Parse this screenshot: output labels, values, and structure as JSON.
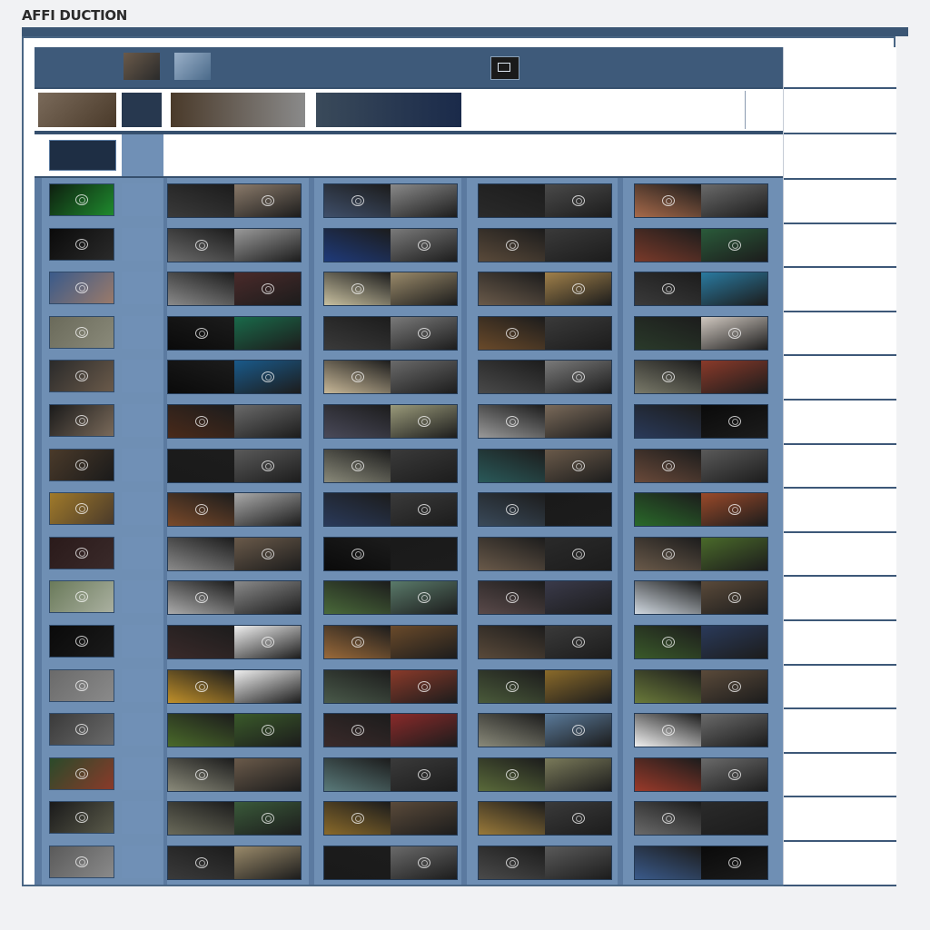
{
  "app": {
    "title": "AFFI DUCTION",
    "subtitle": "",
    "footer": ""
  },
  "colors": {
    "title_bar": "#3b5674",
    "column_blue": "#6f8fb4",
    "header_dark": "#3e5a7a",
    "cell_dark": "#27384f"
  },
  "header": {
    "badge_icon": "image-icon"
  },
  "info_rows": [],
  "grid": {
    "rows": [
      {
        "key": "",
        "thumb": [
          "#0e1f0f",
          "#1f8a2e"
        ],
        "cells": [
          [
            "#3a3a3a",
            "#8a7a6a"
          ],
          [
            "#3f4f6a",
            "#8a8a8a"
          ],
          [
            "#2a2a2a",
            "#4a4a4a"
          ],
          [
            "#a86a4a",
            "#6a6a6a"
          ]
        ]
      },
      {
        "key": "",
        "thumb": [
          "#0a0a0a",
          "#2a2a2a"
        ],
        "cells": [
          [
            "#6a6a6a",
            "#9a9a9a"
          ],
          [
            "#1e3a7a",
            "#7a7a7a"
          ],
          [
            "#5a4a3a",
            "#3a3a3a"
          ],
          [
            "#7a3a2a",
            "#2a5a3a"
          ]
        ]
      },
      {
        "key": "",
        "thumb": [
          "#3a5a8a",
          "#9a7a6a"
        ],
        "cells": [
          [
            "#8a8a8a",
            "#4a2a2a"
          ],
          [
            "#c8c0a0",
            "#9a8a6a"
          ],
          [
            "#6a5a4a",
            "#a0804a"
          ],
          [
            "#3a3a3a",
            "#2a7aa0"
          ]
        ]
      },
      {
        "key": "",
        "thumb": [
          "#6a6a5a",
          "#8a8a7a"
        ],
        "cells": [
          [
            "#0a0a0a",
            "#1a6a4a"
          ],
          [
            "#3a3a3a",
            "#7a7a7a"
          ],
          [
            "#6a4a2a",
            "#3a3a3a"
          ],
          [
            "#2a3a2a",
            "#d0c8c0"
          ]
        ]
      },
      {
        "key": "",
        "thumb": [
          "#2a2a2a",
          "#6a5a4a"
        ],
        "cells": [
          [
            "#0a0a0a",
            "#1a5a8a"
          ],
          [
            "#c8b898",
            "#6a6a6a"
          ],
          [
            "#4a4a4a",
            "#7a7a7a"
          ],
          [
            "#7a7a6a",
            "#8a3a2a"
          ]
        ]
      },
      {
        "key": "",
        "thumb": [
          "#1a1a1a",
          "#7a6a5a"
        ],
        "cells": [
          [
            "#4a2a1a",
            "#6a6a6a"
          ],
          [
            "#4a4a5a",
            "#9a9a7a"
          ],
          [
            "#9a9a9a",
            "#7a6a5a"
          ],
          [
            "#2a3a5a",
            "#0a0a0a"
          ]
        ]
      },
      {
        "key": "",
        "thumb": [
          "#4a3a2a",
          "#1a1a1a"
        ],
        "cells": [
          [
            "#1a1a1a",
            "#5a5a5a"
          ],
          [
            "#8a8a7a",
            "#3a3a3a"
          ],
          [
            "#2a5a5a",
            "#6a5a4a"
          ],
          [
            "#6a4a3a",
            "#5a5a5a"
          ]
        ]
      },
      {
        "key": "",
        "thumb": [
          "#a07a2a",
          "#4a3a2a"
        ],
        "cells": [
          [
            "#7a4a2a",
            "#aaaaaa"
          ],
          [
            "#2a3a5a",
            "#3a3a3a"
          ],
          [
            "#3a4a5a",
            "#1a1a1a"
          ],
          [
            "#2a6a2a",
            "#9a4a2a"
          ]
        ]
      },
      {
        "key": "",
        "thumb": [
          "#2a1a1a",
          "#3a2a2a"
        ],
        "cells": [
          [
            "#8a8a8a",
            "#6a5a4a"
          ],
          [
            "#0a0a0a",
            "#1a1a1a"
          ],
          [
            "#6a5a4a",
            "#2a2a2a"
          ],
          [
            "#6a5a4a",
            "#4a6a2a"
          ]
        ]
      },
      {
        "key": "",
        "thumb": [
          "#6a7a5a",
          "#aab0a0"
        ],
        "cells": [
          [
            "#aaaaaa",
            "#8a8a8a"
          ],
          [
            "#4a6a3a",
            "#5a7a6a"
          ],
          [
            "#5a4a4a",
            "#3a3a4a"
          ],
          [
            "#d0d8e0",
            "#5a4a3a"
          ]
        ]
      },
      {
        "key": "",
        "thumb": [
          "#0a0a0a",
          "#1a1a1a"
        ],
        "cells": [
          [
            "#3a2a2a",
            "#f0f0f0"
          ],
          [
            "#9a6a3a",
            "#6a4a2a"
          ],
          [
            "#5a4a3a",
            "#3a3a3a"
          ],
          [
            "#3a5a2a",
            "#2a3a5a"
          ]
        ]
      },
      {
        "key": "",
        "thumb": [
          "#6a6a6a",
          "#8a8a8a"
        ],
        "cells": [
          [
            "#c0902a",
            "#f0f0f0"
          ],
          [
            "#4a5a4a",
            "#8a3a2a"
          ],
          [
            "#4a5a3a",
            "#8a6a2a"
          ],
          [
            "#6a7a3a",
            "#5a4a3a"
          ]
        ]
      },
      {
        "key": "",
        "thumb": [
          "#3a3a3a",
          "#6a6a6a"
        ],
        "cells": [
          [
            "#4a6a2a",
            "#3a5a2a"
          ],
          [
            "#3a2a2a",
            "#8a2a2a"
          ],
          [
            "#8a8a7a",
            "#5a7a9a"
          ],
          [
            "#f0f0f0",
            "#6a6a6a"
          ]
        ]
      },
      {
        "key": "",
        "thumb": [
          "#2a4a2a",
          "#8a3a2a"
        ],
        "cells": [
          [
            "#8a8a7a",
            "#6a5a4a"
          ],
          [
            "#5a7a7a",
            "#3a3a3a"
          ],
          [
            "#5a6a3a",
            "#7a7a5a"
          ],
          [
            "#9a3a2a",
            "#6a6a6a"
          ]
        ]
      },
      {
        "key": "",
        "thumb": [
          "#1a1a1a",
          "#5a5a4a"
        ],
        "cells": [
          [
            "#6a6a5a",
            "#3a5a3a"
          ],
          [
            "#8a6a2a",
            "#5a4a3a"
          ],
          [
            "#9a7a3a",
            "#3a3a3a"
          ],
          [
            "#6a6a6a",
            "#2a2a2a"
          ]
        ]
      },
      {
        "key": "",
        "thumb": [
          "#5a5a5a",
          "#8a8a8a"
        ],
        "cells": [
          [
            "#3a3a3a",
            "#9a8a6a"
          ],
          [
            "#1a1a1a",
            "#6a6a6a"
          ],
          [
            "#4a4a4a",
            "#5a5a5a"
          ],
          [
            "#3a5a8a",
            "#0a0a0a"
          ]
        ]
      }
    ]
  },
  "side_panel": {
    "items": []
  }
}
